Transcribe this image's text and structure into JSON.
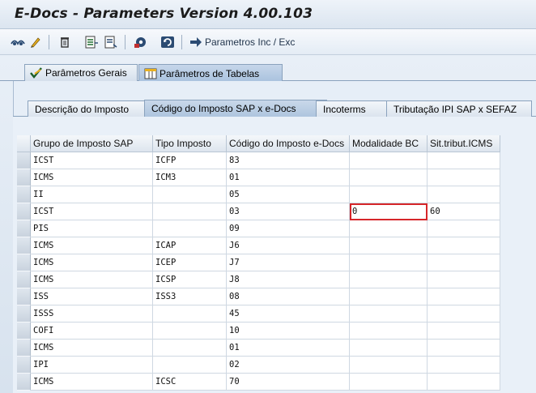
{
  "window": {
    "title": "E-Docs - Parameters Version 4.00.103"
  },
  "toolbar": {
    "icons": [
      "display-change-icon",
      "edit-pencil-icon",
      "delete-trash-icon",
      "export-icon",
      "copy-icon",
      "settings-icon",
      "refresh-icon",
      "arrow-right-icon"
    ],
    "link_label": "Parametros Inc / Exc"
  },
  "tabs_top": [
    {
      "label": "Parâmetros Gerais",
      "active": false
    },
    {
      "label": "Parâmetros de Tabelas",
      "active": true
    }
  ],
  "tabs_sub": [
    {
      "label": "Descrição do Imposto",
      "active": false
    },
    {
      "label": "Código do Imposto SAP x e-Docs",
      "active": true
    },
    {
      "label": "Incoterms",
      "active": false
    },
    {
      "label": "Tributação IPI SAP x SEFAZ",
      "active": false
    }
  ],
  "table": {
    "columns": [
      "Grupo de Imposto SAP",
      "Tipo Imposto",
      "Código do Imposto e-Docs",
      "Modalidade BC",
      "Sit.tribut.ICMS"
    ],
    "rows": [
      [
        "ICST",
        "ICFP",
        "83",
        "",
        ""
      ],
      [
        "ICMS",
        "ICM3",
        "01",
        "",
        ""
      ],
      [
        "II",
        "",
        "05",
        "",
        ""
      ],
      [
        "ICST",
        "",
        "03",
        "0",
        "60"
      ],
      [
        "PIS",
        "",
        "09",
        "",
        ""
      ],
      [
        "ICMS",
        "ICAP",
        "J6",
        "",
        ""
      ],
      [
        "ICMS",
        "ICEP",
        "J7",
        "",
        ""
      ],
      [
        "ICMS",
        "ICSP",
        "J8",
        "",
        ""
      ],
      [
        "ISS",
        "ISS3",
        "08",
        "",
        ""
      ],
      [
        "ISSS",
        "",
        "45",
        "",
        ""
      ],
      [
        "COFI",
        "",
        "10",
        "",
        ""
      ],
      [
        "ICMS",
        "",
        "01",
        "",
        ""
      ],
      [
        "IPI",
        "",
        "02",
        "",
        ""
      ],
      [
        "ICMS",
        "ICSC",
        "70",
        "",
        ""
      ]
    ],
    "highlighted_cell": {
      "row": 3,
      "column": "Modalidade BC"
    }
  },
  "colors": {
    "highlight": "#d6262a",
    "tab_active": "#aec5de",
    "background": "#dfe9f5"
  }
}
